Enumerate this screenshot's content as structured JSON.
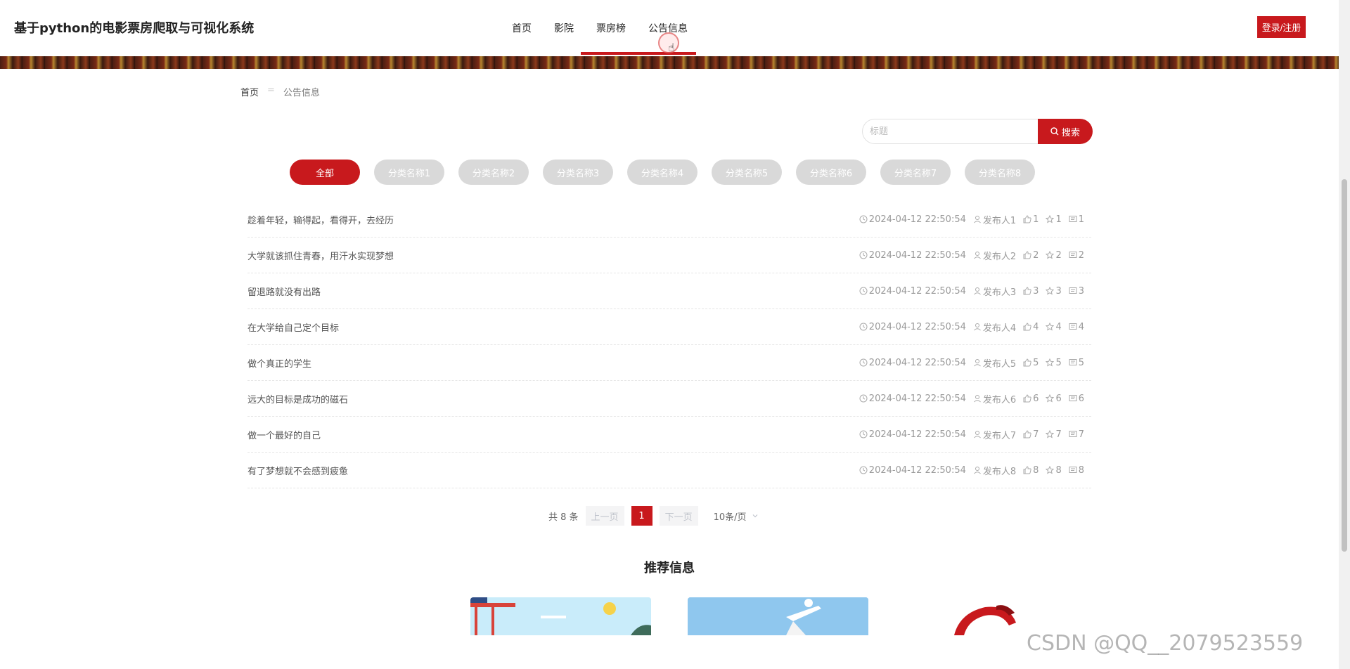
{
  "header": {
    "site_title": "基于python的电影票房爬取与可视化系统",
    "nav": [
      {
        "label": "首页"
      },
      {
        "label": "影院"
      },
      {
        "label": "票房榜"
      },
      {
        "label": "公告信息"
      }
    ],
    "login_label": "登录/注册"
  },
  "breadcrumb": {
    "home": "首页",
    "separator": "=",
    "current": "公告信息"
  },
  "search": {
    "placeholder": "标题",
    "button_label": "搜索"
  },
  "categories": [
    "全部",
    "分类名称1",
    "分类名称2",
    "分类名称3",
    "分类名称4",
    "分类名称5",
    "分类名称6",
    "分类名称7",
    "分类名称8"
  ],
  "list": [
    {
      "title": "趁着年轻，输得起，看得开，去经历",
      "time": "2024-04-12 22:50:54",
      "author": "发布人1",
      "likes": "1",
      "favs": "1",
      "comments": "1"
    },
    {
      "title": "大学就该抓住青春，用汗水实现梦想",
      "time": "2024-04-12 22:50:54",
      "author": "发布人2",
      "likes": "2",
      "favs": "2",
      "comments": "2"
    },
    {
      "title": "留退路就没有出路",
      "time": "2024-04-12 22:50:54",
      "author": "发布人3",
      "likes": "3",
      "favs": "3",
      "comments": "3"
    },
    {
      "title": "在大学给自己定个目标",
      "time": "2024-04-12 22:50:54",
      "author": "发布人4",
      "likes": "4",
      "favs": "4",
      "comments": "4"
    },
    {
      "title": "做个真正的学生",
      "time": "2024-04-12 22:50:54",
      "author": "发布人5",
      "likes": "5",
      "favs": "5",
      "comments": "5"
    },
    {
      "title": "远大的目标是成功的磁石",
      "time": "2024-04-12 22:50:54",
      "author": "发布人6",
      "likes": "6",
      "favs": "6",
      "comments": "6"
    },
    {
      "title": "做一个最好的自己",
      "time": "2024-04-12 22:50:54",
      "author": "发布人7",
      "likes": "7",
      "favs": "7",
      "comments": "7"
    },
    {
      "title": "有了梦想就不会感到疲惫",
      "time": "2024-04-12 22:50:54",
      "author": "发布人8",
      "likes": "8",
      "favs": "8",
      "comments": "8"
    }
  ],
  "pagination": {
    "total": "共 8 条",
    "prev": "上一页",
    "current": "1",
    "next": "下一页",
    "page_size": "10条/页"
  },
  "recommend": {
    "title": "推荐信息"
  },
  "watermark": "CSDN @QQ__2079523559",
  "colors": {
    "accent": "#c8191d",
    "tag_inactive": "#d9d9d9"
  }
}
